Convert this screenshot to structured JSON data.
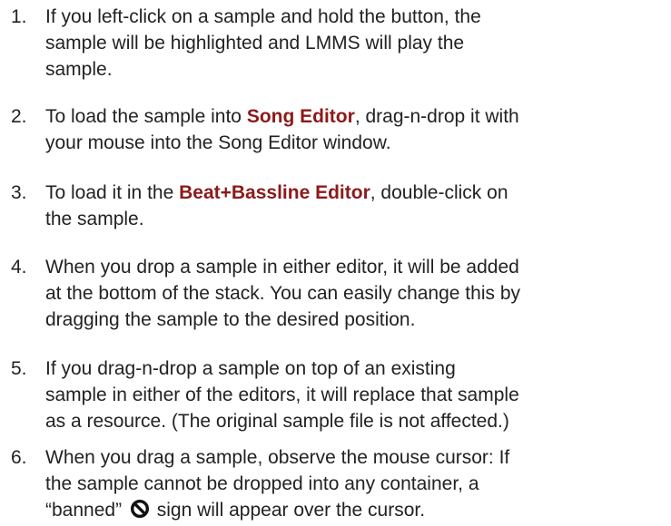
{
  "steps": [
    {
      "number": "1.",
      "lines": [
        "If you left-click on a sample and hold the button, the",
        "sample will be highlighted and LMMS will play the",
        "sample."
      ]
    },
    {
      "number": "2.",
      "line1_prefix": "To load the sample into ",
      "line1_link": "Song Editor",
      "line1_suffix": ", drag-n-drop it with",
      "line2": "your mouse into the Song Editor window."
    },
    {
      "number": "3.",
      "line1_prefix": "To load it in the ",
      "line1_link": "Beat+Bassline Editor",
      "line1_suffix": ", double-click on",
      "line2": "the sample."
    },
    {
      "number": "4.",
      "lines": [
        "When you drop a sample in either editor, it will be added",
        "at the bottom of the stack. You can easily change this by",
        "dragging the sample to the desired position."
      ]
    },
    {
      "number": "5.",
      "lines": [
        "If you drag-n-drop a sample on top of an existing",
        "sample in either of the editors, it will replace that sample",
        "as a resource. (The original sample file is not affected.)"
      ]
    },
    {
      "number": "6.",
      "lines": [
        "When you drag a sample, observe the mouse cursor: If",
        "the sample cannot be dropped into any container, a"
      ],
      "line3_prefix": "“banned” ",
      "line3_icon": "banned-icon",
      "line3_suffix": " sign will appear over the cursor."
    }
  ],
  "colors": {
    "text": "#222222",
    "highlight": "#8b1a1a"
  }
}
